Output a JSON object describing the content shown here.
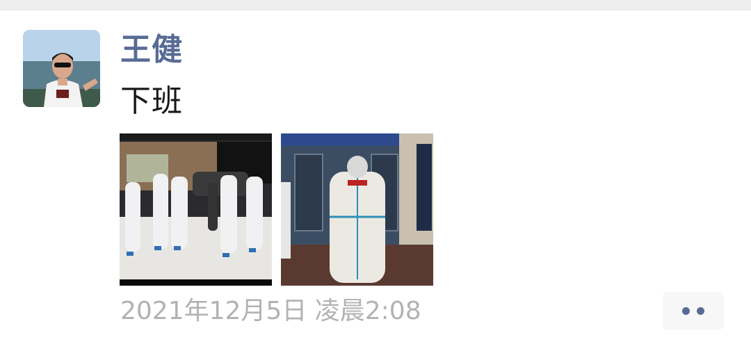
{
  "post": {
    "username": "王健",
    "text": "下班",
    "timestamp": "2021年12月5日 凌晨2:08"
  },
  "photos": [
    {
      "name": "photo-group-protective-suits"
    },
    {
      "name": "photo-person-protective-suit-doorway"
    }
  ],
  "actions": {
    "more_icon": "two-dots-icon"
  },
  "colors": {
    "username": "#576b95",
    "text": "#191919",
    "timestamp": "#b2b2b2",
    "more_button_bg": "#f7f7f7",
    "top_strip": "#ededed"
  }
}
